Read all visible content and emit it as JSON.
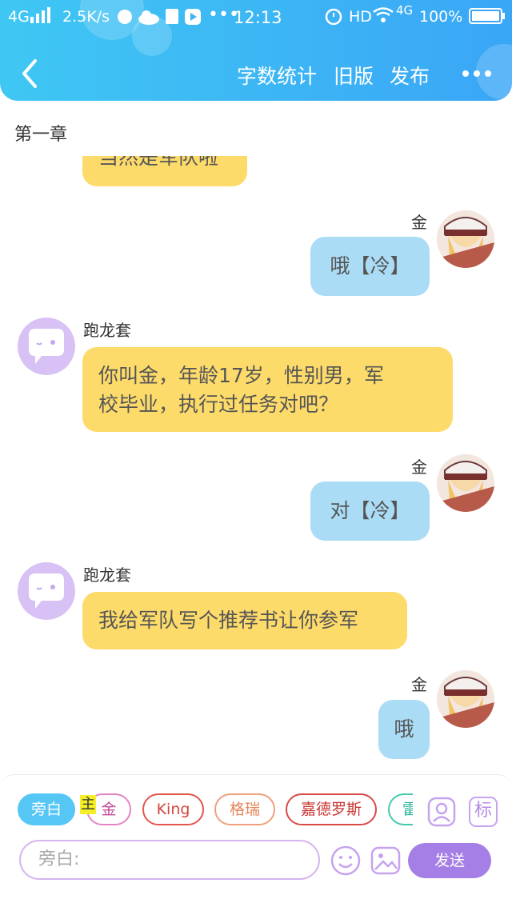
{
  "status_bar": {
    "network": "4G",
    "speed": "2.5K/s",
    "time": "12:13",
    "hd": "HD",
    "net2": "4G",
    "battery": "100%"
  },
  "header": {
    "word_count": "字数统计",
    "old_version": "旧版",
    "publish": "发布"
  },
  "chapter_title": "第一章",
  "messages": [
    {
      "side": "left",
      "speaker": "",
      "text": "当然是军队啦"
    },
    {
      "side": "right",
      "speaker": "金",
      "text": "哦【冷】"
    },
    {
      "side": "left",
      "speaker": "跑龙套",
      "text_line1": "你叫金，年龄17岁，性别男，军",
      "text_line2": "校毕业，执行过任务对吧？"
    },
    {
      "side": "right",
      "speaker": "金",
      "text": "对【冷】"
    },
    {
      "side": "left",
      "speaker": "跑龙套",
      "text": "我给军队写个推荐书让你参军"
    },
    {
      "side": "right",
      "speaker": "金",
      "text": "哦"
    }
  ],
  "character_chips": [
    {
      "label": "旁白",
      "selected": true
    },
    {
      "label": "金",
      "badge": "主"
    },
    {
      "label": "King"
    },
    {
      "label": "格瑞"
    },
    {
      "label": "嘉德罗斯"
    },
    {
      "label": "雷"
    }
  ],
  "tools": {
    "tag_label": "标"
  },
  "composer": {
    "placeholder": "旁白:",
    "send_label": "发送"
  },
  "colors": {
    "header_start": "#3fc7f3",
    "header_end": "#3aa6f6",
    "narration_bubble": "#fddb6b",
    "player_bubble": "#abdcf6",
    "accent_purple": "#a57ee6"
  }
}
